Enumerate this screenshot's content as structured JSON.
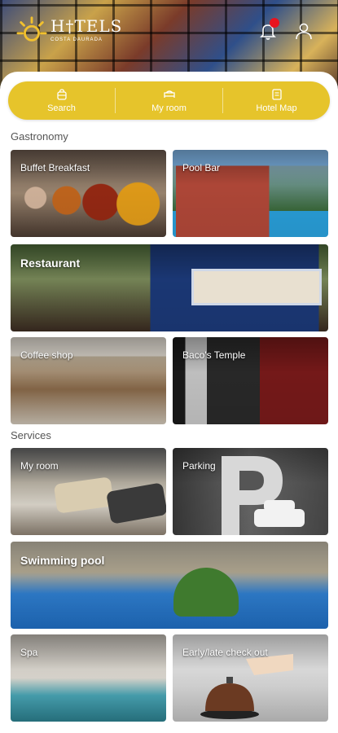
{
  "header": {
    "logo_text": "H†TELS",
    "logo_sub": "COSTA DAURADA",
    "notification_icon": "bell-icon",
    "profile_icon": "user-icon",
    "notification_dot_color": "#e8141f"
  },
  "nav": {
    "accent_color": "#e6c42b",
    "items": [
      {
        "label": "Search",
        "icon": "search-bag-icon"
      },
      {
        "label": "My room",
        "icon": "bed-icon"
      },
      {
        "label": "Hotel Map",
        "icon": "map-icon"
      }
    ]
  },
  "sections": {
    "gastronomy": {
      "title": "Gastronomy",
      "tiles": [
        {
          "label": "Buffet Breakfast"
        },
        {
          "label": "Pool Bar"
        },
        {
          "label": "Restaurant"
        },
        {
          "label": "Coffee shop"
        },
        {
          "label": "Baco's Temple"
        }
      ]
    },
    "services": {
      "title": "Services",
      "tiles": [
        {
          "label": "My room"
        },
        {
          "label": "Parking"
        },
        {
          "label": "Swimming pool"
        },
        {
          "label": "Spa"
        },
        {
          "label": "Early/late check out"
        }
      ]
    }
  }
}
